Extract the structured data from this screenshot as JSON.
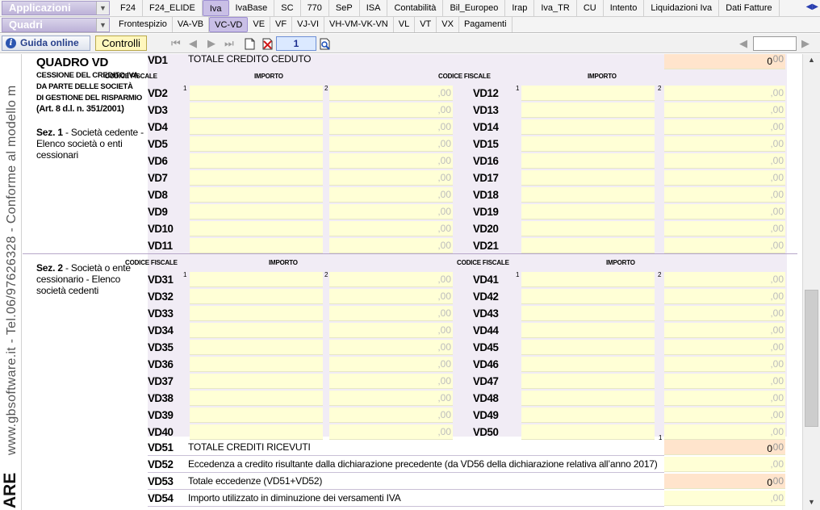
{
  "menu": {
    "applicazioni_label": "Applicazioni",
    "quadri_label": "Quadri",
    "row1_tabs": [
      "F24",
      "F24_ELIDE",
      "Iva",
      "IvaBase",
      "SC",
      "770",
      "SeP",
      "ISA",
      "Contabilità",
      "Bil_Europeo",
      "Irap",
      "Iva_TR",
      "CU",
      "Intento",
      "Liquidazioni Iva",
      "Dati Fatture"
    ],
    "row1_active": "Iva",
    "row2_tabs": [
      "Frontespizio",
      "VA-VB",
      "VC-VD",
      "VE",
      "VF",
      "VJ-VI",
      "VH-VM-VK-VN",
      "VL",
      "VT",
      "VX",
      "Pagamenti"
    ],
    "row2_active": "VC-VD"
  },
  "toolbar": {
    "guida_label": "Guida online",
    "controlli_label": "Controlli",
    "page_number": "1"
  },
  "sidebar": {
    "vertical_text": "www.gbsoftware.it - Tel.06/97626328 - Conforme al modello m",
    "vertical_bold": "ARE"
  },
  "quadro": {
    "title": "QUADRO VD",
    "subtitle_lines": [
      "CESSIONE DEL CREDITO IVA",
      "DA PARTE DELLE SOCIETÀ",
      "DI GESTIONE DEL RISPARMIO"
    ],
    "law_ref": "(Art. 8 d.l. n. 351/2001)",
    "sez1_label": "Sez. 1",
    "sez1_text": " - Società cedente - Elenco società o enti cessionari",
    "sez2_label": "Sez. 2",
    "sez2_text": " - Società o ente cessionario - Elenco società cedenti",
    "header_codice": "CODICE FISCALE",
    "header_importo": "IMPORTO",
    "decimal_suffix": ",00",
    "decimal_suffix_short": "00",
    "vd1": {
      "code": "VD1",
      "desc": "TOTALE CREDITO CEDUTO",
      "value": "0"
    },
    "sez1_left": [
      "VD2",
      "VD3",
      "VD4",
      "VD5",
      "VD6",
      "VD7",
      "VD8",
      "VD9",
      "VD10",
      "VD11"
    ],
    "sez1_right": [
      "VD12",
      "VD13",
      "VD14",
      "VD15",
      "VD16",
      "VD17",
      "VD18",
      "VD19",
      "VD20",
      "VD21"
    ],
    "sez2_left": [
      "VD31",
      "VD32",
      "VD33",
      "VD34",
      "VD35",
      "VD36",
      "VD37",
      "VD38",
      "VD39",
      "VD40"
    ],
    "sez2_right": [
      "VD41",
      "VD42",
      "VD43",
      "VD44",
      "VD45",
      "VD46",
      "VD47",
      "VD48",
      "VD49",
      "VD50"
    ],
    "bottom_rows": [
      {
        "code": "VD51",
        "desc": "TOTALE CREDITI RICEVUTI",
        "value": "0",
        "style": "orange",
        "sup": "1"
      },
      {
        "code": "VD52",
        "desc": "Eccedenza a credito risultante dalla dichiarazione precedente (da VD56 della dichiarazione relativa all’anno 2017)",
        "value": "",
        "style": "yellow"
      },
      {
        "code": "VD53",
        "desc": "Totale eccedenze (VD51+VD52)",
        "value": "0",
        "style": "orange"
      },
      {
        "code": "VD54",
        "desc": "Importo utilizzato in diminuzione dei versamenti IVA",
        "value": "",
        "style": "yellow"
      }
    ]
  }
}
